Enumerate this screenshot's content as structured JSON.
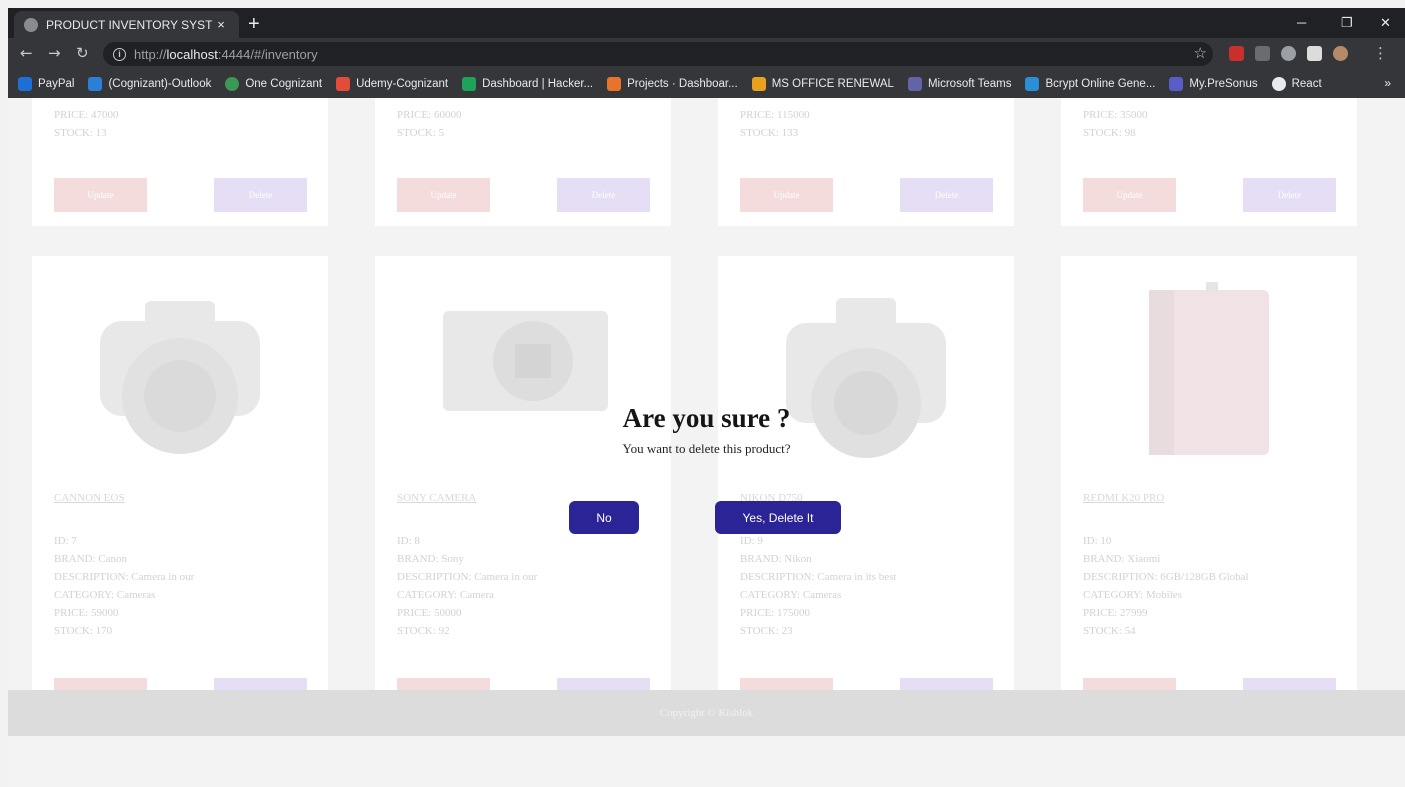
{
  "browser": {
    "tab_title": "PRODUCT INVENTORY SYSTEM",
    "tab_close": "×",
    "new_tab": "+",
    "url_scheme": "http://",
    "url_host": "localhost",
    "url_rest": ":4444/#/inventory",
    "bookmarks": [
      {
        "label": "PayPal",
        "color": "#1d6fd6"
      },
      {
        "label": "(Cognizant)-Outlook",
        "color": "#2b7fd6"
      },
      {
        "label": "One Cognizant",
        "color": "#3a9a55"
      },
      {
        "label": "Udemy-Cognizant",
        "color": "#e44c3a"
      },
      {
        "label": "Dashboard | Hacker...",
        "color": "#1fa35a"
      },
      {
        "label": "Projects · Dashboar...",
        "color": "#e8742c"
      },
      {
        "label": "MS OFFICE RENEWAL",
        "color": "#e8a11c"
      },
      {
        "label": "Microsoft Teams",
        "color": "#6264a7"
      },
      {
        "label": "Bcrypt Online Gene...",
        "color": "#2a8fd6"
      },
      {
        "label": "My.PreSonus",
        "color": "#5a5cc8"
      },
      {
        "label": "React",
        "color": "#e8eaed"
      }
    ],
    "bookmarks_more": "»"
  },
  "cards_top": [
    {
      "price": "PRICE: 47000",
      "stock": "STOCK: 13",
      "update": "Update",
      "delete": "Delete"
    },
    {
      "price": "PRICE: 60000",
      "stock": "STOCK: 5",
      "update": "Update",
      "delete": "Delete"
    },
    {
      "price": "PRICE: 115000",
      "stock": "STOCK: 133",
      "update": "Update",
      "delete": "Delete"
    },
    {
      "price": "PRICE: 35000",
      "stock": "STOCK: 98",
      "update": "Update",
      "delete": "Delete"
    }
  ],
  "cards_bottom": [
    {
      "name": "CANNON EOS",
      "id": "ID: 7",
      "brand": "BRAND: Canon",
      "description": "DESCRIPTION: Camera in our",
      "category": "CATEGORY: Cameras",
      "price": "PRICE: 59000",
      "stock": "STOCK: 170"
    },
    {
      "name": "SONY CAMERA",
      "id": "ID: 8",
      "brand": "BRAND: Sony",
      "description": "DESCRIPTION: Camera in our",
      "category": "CATEGORY: Camera",
      "price": "PRICE: 50000",
      "stock": "STOCK: 92"
    },
    {
      "name": "NIKON D750",
      "id": "ID: 9",
      "brand": "BRAND: Nikon",
      "description": "DESCRIPTION: Camera in its best",
      "category": "CATEGORY: Cameras",
      "price": "PRICE: 175000",
      "stock": "STOCK: 23"
    },
    {
      "name": "REDMI K20 PRO",
      "id": "ID: 10",
      "brand": "BRAND: Xiaomi",
      "description": "DESCRIPTION: 6GB/128GB Global",
      "category": "CATEGORY: Mobiles",
      "price": "PRICE: 27999",
      "stock": "STOCK: 54"
    }
  ],
  "footer": {
    "text": "Copyright © Kishlok"
  },
  "modal": {
    "title": "Are you sure ?",
    "message": "You want to delete this product?",
    "no_label": "No",
    "yes_label": "Yes, Delete It"
  }
}
